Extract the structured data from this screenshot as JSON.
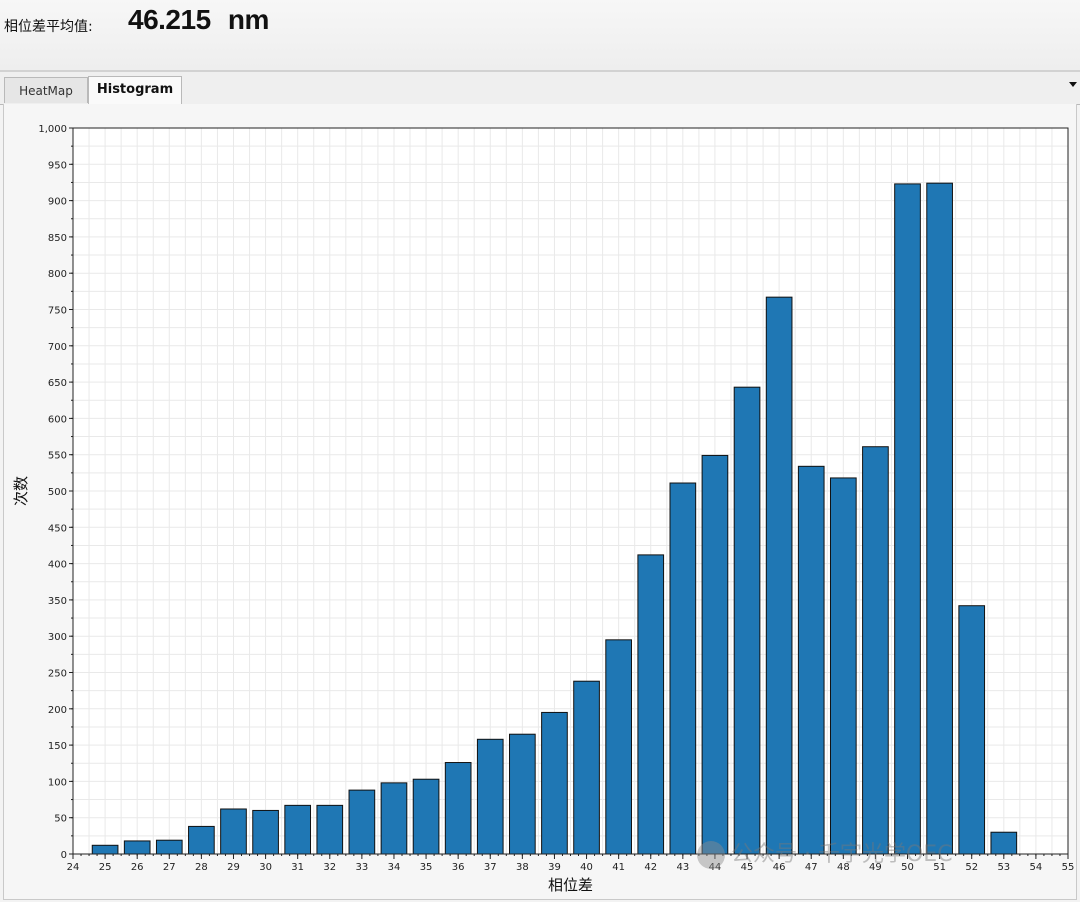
{
  "header": {
    "label": "相位差平均值:",
    "value": "46.215",
    "unit": "nm"
  },
  "tabs": [
    {
      "label": "HeatMap",
      "active": false
    },
    {
      "label": "Histogram",
      "active": true
    }
  ],
  "watermark": "公众号 · 千宇光学OEC",
  "chart_data": {
    "type": "bar",
    "xlabel": "相位差",
    "ylabel": "次数",
    "xlim": [
      24,
      55
    ],
    "ylim": [
      0,
      1000
    ],
    "x_ticks": [
      24,
      25,
      26,
      27,
      28,
      29,
      30,
      31,
      32,
      33,
      34,
      35,
      36,
      37,
      38,
      39,
      40,
      41,
      42,
      43,
      44,
      45,
      46,
      47,
      48,
      49,
      50,
      51,
      52,
      53,
      54,
      55
    ],
    "y_ticks": [
      0,
      50,
      100,
      150,
      200,
      250,
      300,
      350,
      400,
      450,
      500,
      550,
      600,
      650,
      700,
      750,
      800,
      850,
      900,
      950,
      1000
    ],
    "y_tick_labels": [
      "0",
      "50",
      "100",
      "150",
      "200",
      "250",
      "300",
      "350",
      "400",
      "450",
      "500",
      "550",
      "600",
      "650",
      "700",
      "750",
      "800",
      "850",
      "900",
      "950",
      "1,000"
    ],
    "grid": true,
    "bar_color": "#1f77b4",
    "categories": [
      25,
      26,
      27,
      28,
      29,
      30,
      31,
      32,
      33,
      34,
      35,
      36,
      37,
      38,
      39,
      40,
      41,
      42,
      43,
      44,
      45,
      46,
      47,
      48,
      49,
      50,
      51,
      52,
      53,
      54
    ],
    "values": [
      12,
      18,
      19,
      38,
      62,
      60,
      67,
      67,
      88,
      98,
      103,
      126,
      158,
      165,
      195,
      238,
      295,
      412,
      511,
      549,
      643,
      767,
      534,
      518,
      561,
      923,
      924,
      342,
      30
    ]
  }
}
